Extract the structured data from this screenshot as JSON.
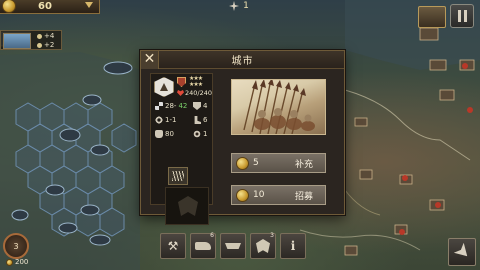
{
  "hud": {
    "coins": "60",
    "turn": "1",
    "mini_info": {
      "row1": "+4",
      "row2": "+2"
    }
  },
  "dialog": {
    "title": "城市",
    "close_label": "✕",
    "unit": {
      "hp": "240/240",
      "attack_base": "28-",
      "attack_bonus": "42",
      "defense": "4",
      "range": "1-1",
      "movement": "6",
      "kills": "80",
      "sight": "1"
    },
    "buttons": {
      "resupply": {
        "cost": "5",
        "label": "补充"
      },
      "recruit": {
        "cost": "10",
        "label": "招募"
      }
    }
  },
  "bottom": {
    "commander_level": "3",
    "commander_count": "200",
    "toolbar": [
      {
        "name": "build",
        "icon": "hammer-icon",
        "badge": ""
      },
      {
        "name": "land-units",
        "icon": "tank-icon",
        "badge": "6"
      },
      {
        "name": "naval-units",
        "icon": "ship-icon",
        "badge": ""
      },
      {
        "name": "air-units",
        "icon": "emblem-icon",
        "badge": "3"
      },
      {
        "name": "info",
        "icon": "info-icon",
        "badge": ""
      }
    ]
  }
}
